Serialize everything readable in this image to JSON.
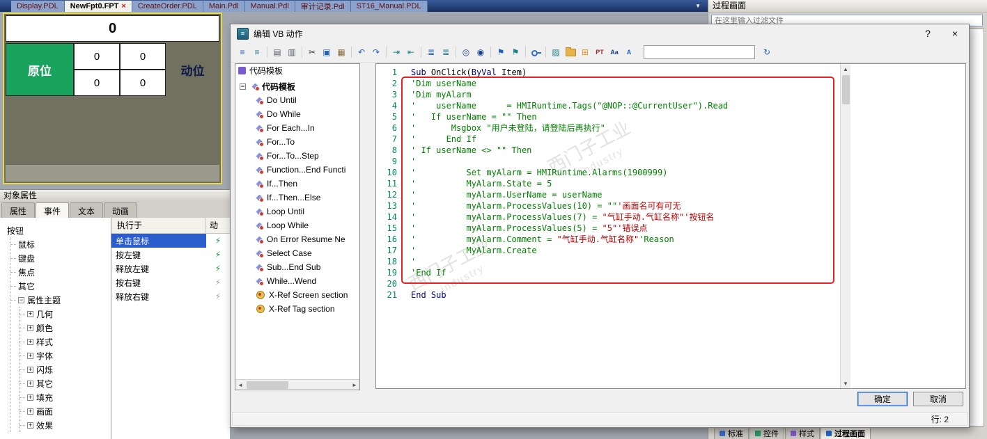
{
  "tabbar": {
    "close_glyph": "×",
    "dropdown_glyph": "▼",
    "items": [
      {
        "label": "Display.PDL",
        "active": false
      },
      {
        "label": "NewFpt0.FPT",
        "active": true
      },
      {
        "label": "CreateOrder.PDL",
        "active": false
      },
      {
        "label": "Main.Pdl",
        "active": false
      },
      {
        "label": "Manual.Pdl",
        "active": false
      },
      {
        "label": "审计记录.Pdl",
        "active": false
      },
      {
        "label": "ST16_Manual.PDL",
        "active": false
      }
    ]
  },
  "screen_editor": {
    "counter": "0",
    "left_label": "原位",
    "right_label": "动位",
    "grid": [
      "0",
      "0",
      "0",
      "0"
    ]
  },
  "properties": {
    "title": "对象属性",
    "tabs": [
      {
        "label": "属性",
        "active": false
      },
      {
        "label": "事件",
        "active": true
      },
      {
        "label": "文本",
        "active": false
      },
      {
        "label": "动画",
        "active": false
      }
    ],
    "tree": {
      "root": "按钮",
      "items": [
        "鼠标",
        "键盘",
        "焦点",
        "其它"
      ],
      "group": "属性主题",
      "group_children": [
        "几何",
        "颜色",
        "样式",
        "字体",
        "闪烁",
        "其它",
        "填充",
        "画面",
        "效果"
      ]
    },
    "events": {
      "col1": "执行于",
      "col2": "动",
      "rows": [
        {
          "label": "单击鼠标",
          "selected": true,
          "icon_color": "#1f9e3c"
        },
        {
          "label": "按左键",
          "selected": false,
          "icon_color": "#1f9e3c"
        },
        {
          "label": "释放左键",
          "selected": false,
          "icon_color": "#1f9e3c"
        },
        {
          "label": "按右键",
          "selected": false,
          "icon_color": "#9aa0a6"
        },
        {
          "label": "释放右键",
          "selected": false,
          "icon_color": "#9aa0a6"
        }
      ]
    }
  },
  "right_panel": {
    "title": "过程画面",
    "filter_placeholder": "在这里输入过滤文件",
    "bottom_tabs": [
      {
        "label": "标准",
        "color": "#3a6bd0",
        "selected": false
      },
      {
        "label": "控件",
        "color": "#2a9a6a",
        "selected": false
      },
      {
        "label": "样式",
        "color": "#8a5ad0",
        "selected": false
      },
      {
        "label": "过程画面",
        "color": "#2a6ad0",
        "selected": true
      }
    ]
  },
  "dialog": {
    "title": "编辑 VB 动作",
    "help_glyph": "?",
    "close_glyph": "×",
    "toolbar": {
      "combo_value": "",
      "icons": [
        {
          "name": "outline-icon",
          "g": "≡",
          "c": "#2060c0"
        },
        {
          "name": "list-icon",
          "g": "≡",
          "c": "#1d7f8c"
        },
        {
          "sep": 1
        },
        {
          "name": "print-icon",
          "g": "▤",
          "c": "#5a6068"
        },
        {
          "name": "print-preview-icon",
          "g": "▥",
          "c": "#5a6068"
        },
        {
          "sep": 1
        },
        {
          "name": "cut-icon",
          "g": "✂",
          "c": "#3a3f45"
        },
        {
          "name": "copy-icon",
          "g": "▣",
          "c": "#2060c0"
        },
        {
          "name": "paste-icon",
          "g": "▦",
          "c": "#8a6d3b"
        },
        {
          "sep": 1
        },
        {
          "name": "undo-icon",
          "g": "↶",
          "c": "#2060c0"
        },
        {
          "name": "redo-icon",
          "g": "↷",
          "c": "#2060c0"
        },
        {
          "sep": 1
        },
        {
          "name": "indent-right-icon",
          "g": "⇥",
          "c": "#1d7f8c"
        },
        {
          "name": "indent-left-icon",
          "g": "⇤",
          "c": "#1d7f8c"
        },
        {
          "sep": 1
        },
        {
          "name": "comment-block-icon",
          "g": "≣",
          "c": "#2060c0"
        },
        {
          "name": "uncomment-block-icon",
          "g": "≣",
          "c": "#1d7f8c"
        },
        {
          "sep": 1
        },
        {
          "name": "find-icon",
          "g": "◎",
          "c": "#123d8f"
        },
        {
          "name": "find-next-icon",
          "g": "◉",
          "c": "#123d8f"
        },
        {
          "sep": 1
        },
        {
          "name": "bookmark-icon",
          "g": "⚑",
          "c": "#2060c0"
        },
        {
          "name": "bookmark-next-icon",
          "g": "⚑",
          "c": "#1d7f8c"
        },
        {
          "sep": 1
        },
        {
          "name": "key-icon",
          "css": "key"
        },
        {
          "sep": 1
        },
        {
          "name": "export-icon",
          "g": "▨",
          "c": "#1d7f8c"
        },
        {
          "name": "folder-icon",
          "css": "folder"
        },
        {
          "name": "package-icon",
          "g": "⊞",
          "c": "#e09a2d"
        },
        {
          "name": "pt-icon",
          "g": "PT",
          "c": "#a03030",
          "text": 1
        },
        {
          "name": "font-case-icon",
          "g": "Aa",
          "c": "#123d8f",
          "text": 1
        },
        {
          "name": "charmap-icon",
          "g": "A",
          "c": "#2060c0",
          "text": 1
        },
        {
          "combo": 1
        },
        {
          "name": "refresh-icon",
          "g": "↻",
          "c": "#2060c0"
        }
      ]
    },
    "templates": {
      "header": "代码模板",
      "root": "代码模板",
      "items": [
        "Do Until",
        "Do While",
        "For Each...In",
        "For...To",
        "For...To...Step",
        "Function...End Functi",
        "If...Then",
        "If...Then...Else",
        "Loop Until",
        "Loop While",
        "On Error Resume Ne",
        "Select Case",
        "Sub...End Sub",
        "While...Wend"
      ],
      "xref_items": [
        "X-Ref Screen section",
        "X-Ref Tag section"
      ]
    },
    "code": {
      "lines": [
        {
          "n": 1,
          "s": [
            {
              "t": "Sub",
              "x": "k"
            },
            {
              "t": " OnClick(",
              "x": "p"
            },
            {
              "t": "ByVal",
              "x": "k"
            },
            {
              "t": " Item)",
              "x": "p"
            }
          ]
        },
        {
          "n": 2,
          "s": [
            {
              "t": "'Dim userName",
              "x": "c"
            }
          ]
        },
        {
          "n": 3,
          "s": [
            {
              "t": "'Dim myAlarm",
              "x": "c"
            }
          ]
        },
        {
          "n": 4,
          "s": [
            {
              "t": "'    userName      = HMIRuntime.Tags(\"@NOP::@CurrentUser\").Read",
              "x": "c"
            }
          ]
        },
        {
          "n": 5,
          "s": [
            {
              "t": "'   If userName = \"\" Then",
              "x": "c"
            }
          ]
        },
        {
          "n": 6,
          "s": [
            {
              "t": "'       Msgbox \"用户未登陆，请登陆后再执行\"",
              "x": "c"
            }
          ]
        },
        {
          "n": 7,
          "s": [
            {
              "t": "'      End If",
              "x": "c"
            }
          ]
        },
        {
          "n": 8,
          "s": [
            {
              "t": "' If userName <> \"\" Then",
              "x": "c"
            }
          ]
        },
        {
          "n": 9,
          "s": [
            {
              "t": "'",
              "x": "c"
            }
          ]
        },
        {
          "n": 10,
          "s": [
            {
              "t": "'          Set myAlarm = HMIRuntime.Alarms(1900999)",
              "x": "c"
            }
          ]
        },
        {
          "n": 11,
          "s": [
            {
              "t": "'          MyAlarm.State = 5",
              "x": "c"
            }
          ]
        },
        {
          "n": 12,
          "s": [
            {
              "t": "'          myAlarm.UserName = userName",
              "x": "c"
            }
          ]
        },
        {
          "n": 13,
          "s": [
            {
              "t": "'          myAlarm.ProcessValues(10) = \"\"",
              "x": "c"
            },
            {
              "t": "'画面名可有可无",
              "x": "r"
            }
          ]
        },
        {
          "n": 14,
          "s": [
            {
              "t": "'          myAlarm.ProcessValues(7) = ",
              "x": "c"
            },
            {
              "t": "\"气缸手动.气缸名称\"'按钮名",
              "x": "r"
            }
          ]
        },
        {
          "n": 15,
          "s": [
            {
              "t": "'          myAlarm.ProcessValues(5) = ",
              "x": "c"
            },
            {
              "t": "\"5\"'错误点",
              "x": "r"
            }
          ]
        },
        {
          "n": 16,
          "s": [
            {
              "t": "'          myAlarm.Comment = ",
              "x": "c"
            },
            {
              "t": "\"气缸手动.气缸名称\"",
              "x": "r"
            },
            {
              "t": "'Reason",
              "x": "c"
            }
          ]
        },
        {
          "n": 17,
          "s": [
            {
              "t": "'          MyAlarm.Create",
              "x": "c"
            }
          ]
        },
        {
          "n": 18,
          "s": [
            {
              "t": "'",
              "x": "c"
            }
          ]
        },
        {
          "n": 19,
          "s": [
            {
              "t": "'End If",
              "x": "c"
            }
          ]
        },
        {
          "n": 20,
          "s": []
        },
        {
          "n": 21,
          "s": [
            {
              "t": "End Sub",
              "x": "k"
            }
          ]
        }
      ]
    },
    "buttons": {
      "ok": "确定",
      "cancel": "取消"
    },
    "status_line": "行:  2"
  },
  "watermark": {
    "cn": "西门子工业",
    "en": "industry"
  }
}
